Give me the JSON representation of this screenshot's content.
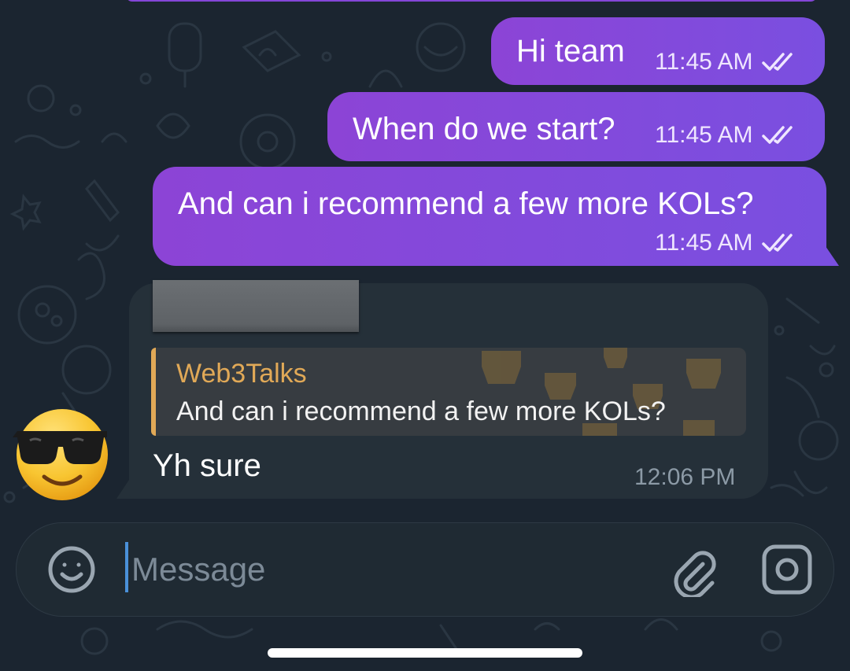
{
  "chat": {
    "outgoing": [
      {
        "text": "Hi team",
        "time": "11:45 AM",
        "status_icon": "double-check-icon"
      },
      {
        "text": "When do we start?",
        "time": "11:45 AM",
        "status_icon": "double-check-icon"
      },
      {
        "text": "And can i recommend a few more KOLs?",
        "time": "11:45 AM",
        "status_icon": "double-check-icon"
      }
    ],
    "incoming": {
      "reply": {
        "name": "Web3Talks",
        "text": "And can i recommend a few more KOLs?"
      },
      "text": "Yh sure",
      "time": "12:06 PM",
      "avatar_icon": "sunglasses-emoji-avatar"
    }
  },
  "composer": {
    "placeholder": "Message",
    "emoji_icon": "smiley-icon",
    "attach_icon": "paperclip-icon",
    "camera_icon": "camera-icon"
  },
  "colors": {
    "background": "#1b2530",
    "outgoing_bubble": "#8446d8",
    "incoming_bubble": "#253039",
    "reply_accent": "#e1a957",
    "cursor": "#4a90d9"
  }
}
